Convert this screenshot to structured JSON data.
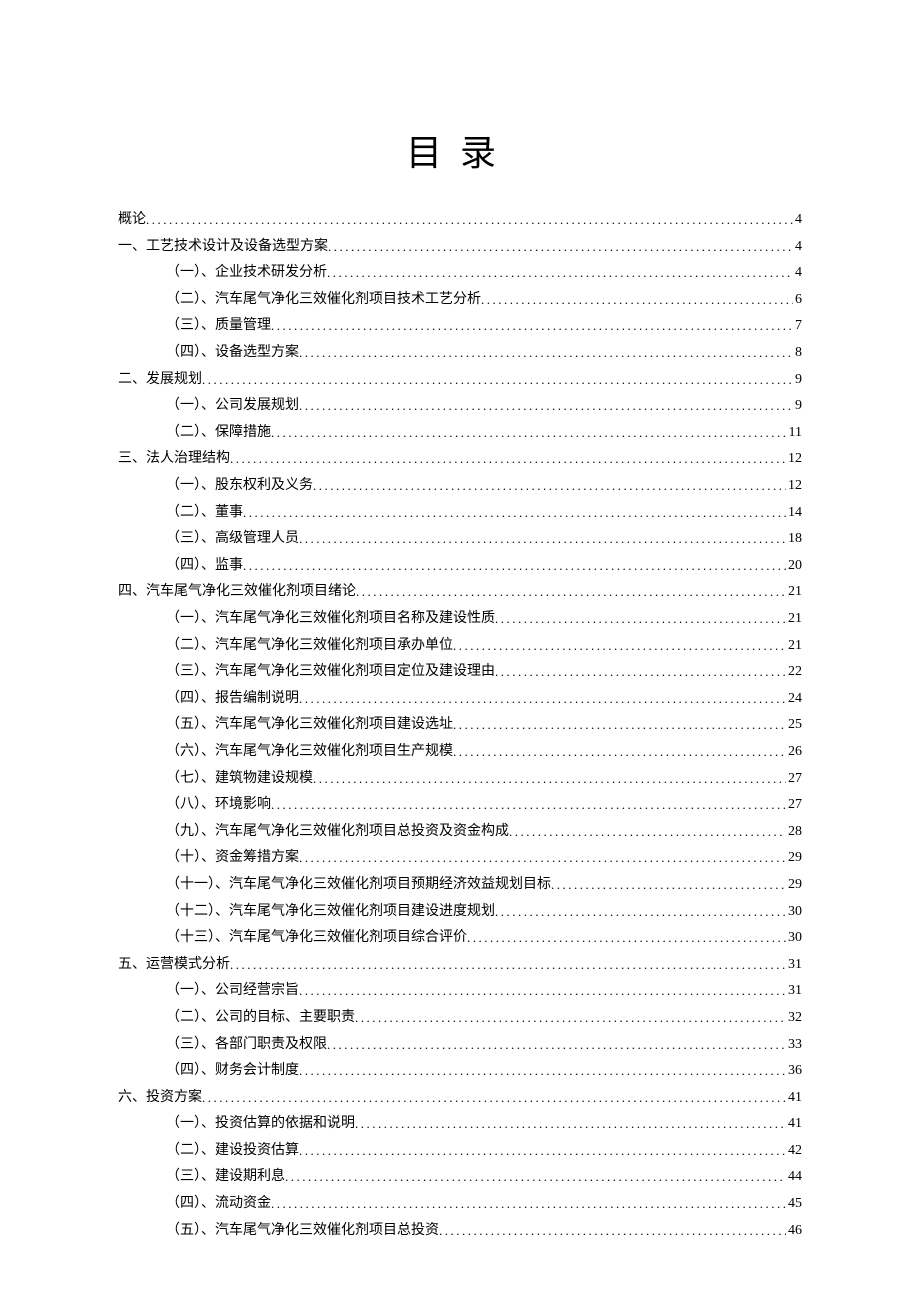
{
  "title": "目录",
  "entries": [
    {
      "level": 1,
      "label": "概论",
      "page": "4"
    },
    {
      "level": 1,
      "label": "一、工艺技术设计及设备选型方案",
      "page": "4"
    },
    {
      "level": 2,
      "label": "（一）、企业技术研发分析",
      "page": "4"
    },
    {
      "level": 2,
      "label": "（二）、汽车尾气净化三效催化剂项目技术工艺分析",
      "page": "6"
    },
    {
      "level": 2,
      "label": "（三）、质量管理",
      "page": "7"
    },
    {
      "level": 2,
      "label": "（四）、设备选型方案",
      "page": "8"
    },
    {
      "level": 1,
      "label": "二、发展规划",
      "page": "9"
    },
    {
      "level": 2,
      "label": "（一）、公司发展规划",
      "page": "9"
    },
    {
      "level": 2,
      "label": "（二）、保障措施",
      "page": "11"
    },
    {
      "level": 1,
      "label": "三、法人治理结构",
      "page": "12"
    },
    {
      "level": 2,
      "label": "（一）、股东权利及义务",
      "page": "12"
    },
    {
      "level": 2,
      "label": "（二）、董事",
      "page": "14"
    },
    {
      "level": 2,
      "label": "（三）、高级管理人员",
      "page": "18"
    },
    {
      "level": 2,
      "label": "（四）、监事",
      "page": "20"
    },
    {
      "level": 1,
      "label": "四、汽车尾气净化三效催化剂项目绪论",
      "page": "21"
    },
    {
      "level": 2,
      "label": "（一）、汽车尾气净化三效催化剂项目名称及建设性质",
      "page": "21"
    },
    {
      "level": 2,
      "label": "（二）、汽车尾气净化三效催化剂项目承办单位",
      "page": "21"
    },
    {
      "level": 2,
      "label": "（三）、汽车尾气净化三效催化剂项目定位及建设理由",
      "page": "22"
    },
    {
      "level": 2,
      "label": "（四）、报告编制说明",
      "page": "24"
    },
    {
      "level": 2,
      "label": "（五）、汽车尾气净化三效催化剂项目建设选址",
      "page": "25"
    },
    {
      "level": 2,
      "label": "（六）、汽车尾气净化三效催化剂项目生产规模",
      "page": "26"
    },
    {
      "level": 2,
      "label": "（七）、建筑物建设规模",
      "page": "27"
    },
    {
      "level": 2,
      "label": "（八）、环境影响",
      "page": "27"
    },
    {
      "level": 2,
      "label": "（九）、汽车尾气净化三效催化剂项目总投资及资金构成",
      "page": "28"
    },
    {
      "level": 2,
      "label": "（十）、资金筹措方案",
      "page": "29"
    },
    {
      "level": 2,
      "label": "（十一）、汽车尾气净化三效催化剂项目预期经济效益规划目标",
      "page": "29"
    },
    {
      "level": 2,
      "label": "（十二）、汽车尾气净化三效催化剂项目建设进度规划",
      "page": "30"
    },
    {
      "level": 2,
      "label": "（十三）、汽车尾气净化三效催化剂项目综合评价",
      "page": "30"
    },
    {
      "level": 1,
      "label": "五、运营模式分析",
      "page": "31"
    },
    {
      "level": 2,
      "label": "（一）、公司经营宗旨",
      "page": "31"
    },
    {
      "level": 2,
      "label": "（二）、公司的目标、主要职责",
      "page": "32"
    },
    {
      "level": 2,
      "label": "（三）、各部门职责及权限",
      "page": "33"
    },
    {
      "level": 2,
      "label": "（四）、财务会计制度",
      "page": "36"
    },
    {
      "level": 1,
      "label": "六、投资方案",
      "page": "41"
    },
    {
      "level": 2,
      "label": "（一）、投资估算的依据和说明",
      "page": "41"
    },
    {
      "level": 2,
      "label": "（二）、建设投资估算",
      "page": "42"
    },
    {
      "level": 2,
      "label": "（三）、建设期利息",
      "page": "44"
    },
    {
      "level": 2,
      "label": "（四）、流动资金",
      "page": "45"
    },
    {
      "level": 2,
      "label": "（五）、汽车尾气净化三效催化剂项目总投资",
      "page": "46"
    }
  ]
}
